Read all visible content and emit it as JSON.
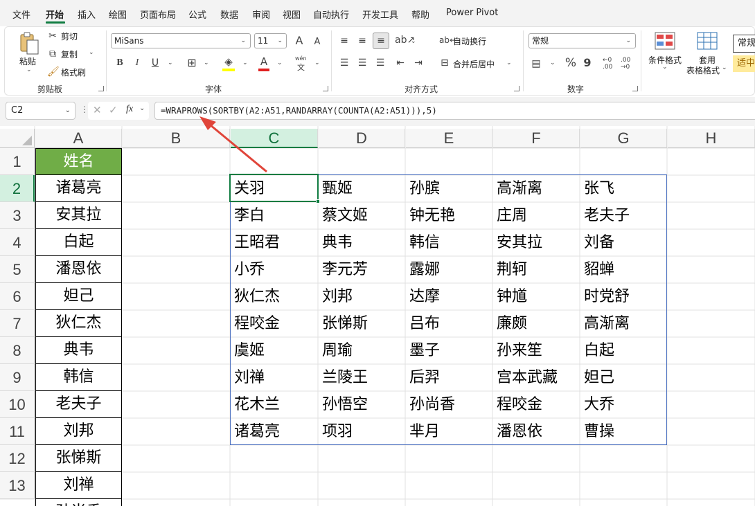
{
  "menu": {
    "tabs": [
      "文件",
      "开始",
      "插入",
      "绘图",
      "页面布局",
      "公式",
      "数据",
      "审阅",
      "视图",
      "自动执行",
      "开发工具",
      "帮助",
      "Power Pivot"
    ],
    "active_index": 1
  },
  "ribbon": {
    "clipboard": {
      "paste": "粘贴",
      "cut": "剪切",
      "copy": "复制",
      "format_painter": "格式刷",
      "group": "剪贴板"
    },
    "font": {
      "name": "MiSans",
      "size": "11",
      "grow": "A",
      "shrink": "A",
      "bold": "B",
      "italic": "I",
      "underline": "U",
      "wen": "wén",
      "wen_sub": "文",
      "font_color_letter": "A",
      "group": "字体"
    },
    "alignment": {
      "wrap": "自动换行",
      "merge": "合并后居中",
      "group": "对齐方式"
    },
    "number": {
      "format": "常规",
      "percent": "%",
      "comma": "9",
      "inc_decimal_top": "←0",
      "inc_decimal_bottom": ".00",
      "dec_decimal_top": ".00",
      "dec_decimal_bottom": "→0",
      "group": "数字"
    },
    "styles": {
      "conditional": "条件格式",
      "table_line1": "套用",
      "table_line2": "表格格式",
      "style1": "常规",
      "style2": "适中"
    }
  },
  "formula_bar": {
    "name_box": "C2",
    "fx": "fx",
    "formula": "=WRAPROWS(SORTBY(A2:A51,RANDARRAY(COUNTA(A2:A51))),5)"
  },
  "sheet": {
    "columns": [
      "A",
      "B",
      "C",
      "D",
      "E",
      "F",
      "G",
      "H"
    ],
    "rows": [
      "1",
      "2",
      "3",
      "4",
      "5",
      "6",
      "7",
      "8",
      "9",
      "10",
      "11",
      "12",
      "13"
    ],
    "header_cell": "姓名",
    "col_a": [
      "诸葛亮",
      "安其拉",
      "白起",
      "潘恩依",
      "妲己",
      "狄仁杰",
      "典韦",
      "韩信",
      "老夫子",
      "刘邦",
      "张悌斯",
      "刘禅",
      "孙尚香"
    ],
    "spill": [
      [
        "关羽",
        "甄姬",
        "孙膑",
        "高渐离",
        "张飞"
      ],
      [
        "李白",
        "蔡文姬",
        "钟无艳",
        "庄周",
        "老夫子"
      ],
      [
        "王昭君",
        "典韦",
        "韩信",
        "安其拉",
        "刘备"
      ],
      [
        "小乔",
        "李元芳",
        "露娜",
        "荆轲",
        "貂蝉"
      ],
      [
        "狄仁杰",
        "刘邦",
        "达摩",
        "钟馗",
        "时党舒"
      ],
      [
        "程咬金",
        "张悌斯",
        "吕布",
        "廉颇",
        "高渐离"
      ],
      [
        "虞姬",
        "周瑜",
        "墨子",
        "孙来笙",
        "白起"
      ],
      [
        "刘禅",
        "兰陵王",
        "后羿",
        "宫本武藏",
        "妲己"
      ],
      [
        "花木兰",
        "孙悟空",
        "孙尚香",
        "程咬金",
        "大乔"
      ],
      [
        "诸葛亮",
        "项羽",
        "芈月",
        "潘恩依",
        "曹操"
      ]
    ]
  },
  "colors": {
    "header_fill": "#70ad47",
    "excel_green": "#107c41",
    "spill_border": "#4a6fbf",
    "arrow": "#e0453a"
  }
}
